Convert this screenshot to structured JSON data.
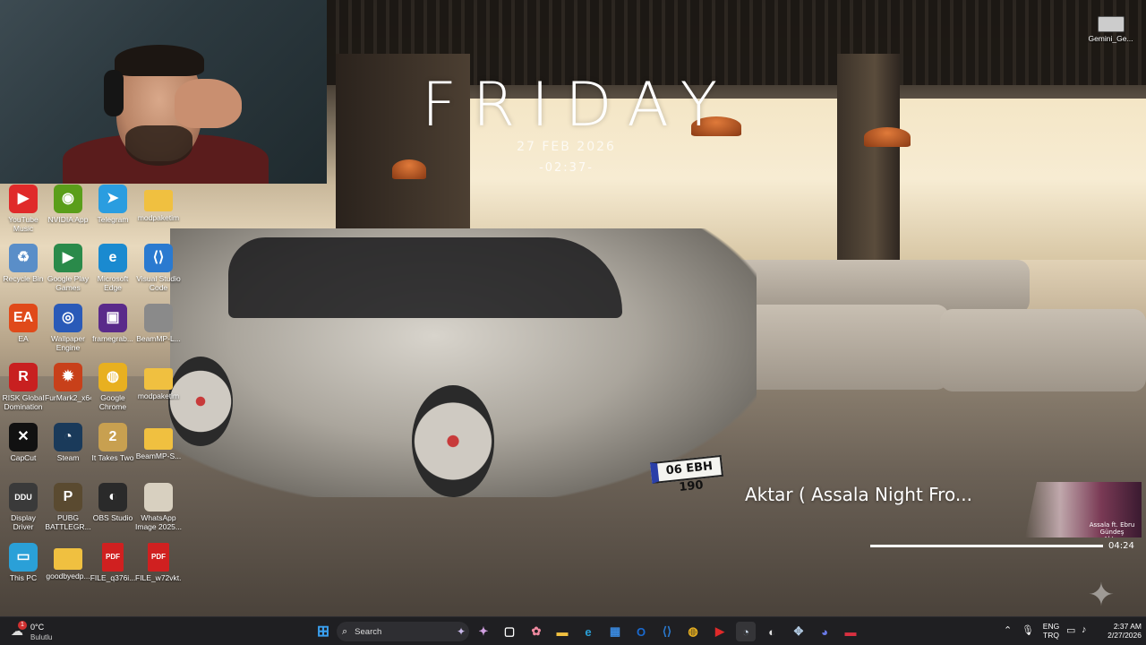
{
  "desktop": {
    "clock_widget": {
      "title": "FRIDAY",
      "date": "27 FEB 2026",
      "time": "-02:37-"
    },
    "icons": [
      {
        "label": "YouTube Music",
        "icon": "youtube-music-icon",
        "color": "#e02a2a",
        "glyph": "▶"
      },
      {
        "label": "NVIDIA App",
        "icon": "nvidia-icon",
        "color": "#5a9e1a",
        "glyph": "◉"
      },
      {
        "label": "Telegram",
        "icon": "telegram-icon",
        "color": "#2a9de0",
        "glyph": "➤"
      },
      {
        "label": "modpaketim",
        "icon": "folder-icon",
        "color": "#f0c040",
        "glyph": ""
      },
      {
        "label": "Recycle Bin",
        "icon": "recycle-bin-icon",
        "color": "#5a8ec8",
        "glyph": "♻"
      },
      {
        "label": "Google Play Games",
        "icon": "google-play-games-icon",
        "color": "#2a8a4a",
        "glyph": "▶"
      },
      {
        "label": "Microsoft Edge",
        "icon": "edge-icon",
        "color": "#1a8ad0",
        "glyph": "e"
      },
      {
        "label": "Visual Studio Code",
        "icon": "vscode-icon",
        "color": "#2a7ad0",
        "glyph": "⟨⟩"
      },
      {
        "label": "EA",
        "icon": "ea-icon",
        "color": "#e04a1a",
        "glyph": "EA"
      },
      {
        "label": "Wallpaper Engine",
        "icon": "wallpaper-engine-icon",
        "color": "#2a5ab8",
        "glyph": "◎"
      },
      {
        "label": "framegrab...",
        "icon": "framegrab-icon",
        "color": "#5a2a8a",
        "glyph": "▣"
      },
      {
        "label": "BeamMP-L...",
        "icon": "beammp-launcher-icon",
        "color": "#8a8a8a",
        "glyph": ""
      },
      {
        "label": "RISK Global Domination",
        "icon": "risk-icon",
        "color": "#c82020",
        "glyph": "R"
      },
      {
        "label": "FurMark2_x64",
        "icon": "furmark-icon",
        "color": "#c8401a",
        "glyph": "✹"
      },
      {
        "label": "Google Chrome",
        "icon": "chrome-icon",
        "color": "#e8b020",
        "glyph": "◍"
      },
      {
        "label": "modpaketim",
        "icon": "folder-icon",
        "color": "#f0c040",
        "glyph": ""
      },
      {
        "label": "CapCut",
        "icon": "capcut-icon",
        "color": "#111111",
        "glyph": "✕"
      },
      {
        "label": "Steam",
        "icon": "steam-icon",
        "color": "#1a3a5a",
        "glyph": "◔"
      },
      {
        "label": "It Takes Two",
        "icon": "it-takes-two-icon",
        "color": "#c8a050",
        "glyph": "2"
      },
      {
        "label": "BeamMP-S...",
        "icon": "folder-icon",
        "color": "#f0c040",
        "glyph": ""
      },
      {
        "label": "Display Driver Uninstaller",
        "icon": "ddu-icon",
        "color": "#3a3a3a",
        "glyph": "DDU"
      },
      {
        "label": "PUBG BATTLEGR...",
        "icon": "pubg-icon",
        "color": "#5a4a30",
        "glyph": "P"
      },
      {
        "label": "OBS Studio",
        "icon": "obs-icon",
        "color": "#2a2a2a",
        "glyph": "◐"
      },
      {
        "label": "WhatsApp Image 2025...",
        "icon": "image-file-icon",
        "color": "#d8d0c0",
        "glyph": ""
      },
      {
        "label": "This PC",
        "icon": "this-pc-icon",
        "color": "#2aa0d8",
        "glyph": "▭"
      },
      {
        "label": "goodbyedp...",
        "icon": "folder-icon",
        "color": "#f0c040",
        "glyph": ""
      },
      {
        "label": "FILE_q376i...",
        "icon": "pdf-icon",
        "color": "#d02020",
        "glyph": "PDF"
      },
      {
        "label": "FILE_w72vkt...",
        "icon": "pdf-icon",
        "color": "#d02020",
        "glyph": "PDF"
      }
    ],
    "corner_item": {
      "label": "Gemini_Ge...",
      "icon": "image-file-icon"
    }
  },
  "car": {
    "plate": "06 EBH 190"
  },
  "media": {
    "title": "Aktar ( Assala Night Fro...",
    "art_text_1": "Assala ft. Ebru Gündeş",
    "art_text_2": "Aktar",
    "time": "04:24",
    "progress": 1.0
  },
  "taskbar": {
    "weather": {
      "temp": "0°C",
      "desc": "Bulutlu",
      "badge": "1"
    },
    "search_placeholder": "Search",
    "apps": [
      {
        "name": "start-button",
        "icon": "windows-icon",
        "color": "#3aa0f0",
        "glyph": "⊞"
      },
      {
        "name": "copilot",
        "icon": "copilot-icon",
        "color": "#d0a0e0",
        "glyph": "✦"
      },
      {
        "name": "task-view",
        "icon": "task-view-icon",
        "color": "#ffffff",
        "glyph": "▢"
      },
      {
        "name": "widgets",
        "icon": "widgets-icon",
        "color": "#f08aa0",
        "glyph": "✿"
      },
      {
        "name": "file-explorer",
        "icon": "folder-icon",
        "color": "#f0c040",
        "glyph": "▬"
      },
      {
        "name": "edge",
        "icon": "edge-icon",
        "color": "#2aa0d8",
        "glyph": "e"
      },
      {
        "name": "store",
        "icon": "store-icon",
        "color": "#3a8ae0",
        "glyph": "▦"
      },
      {
        "name": "outlook",
        "icon": "outlook-icon",
        "color": "#1a6ad0",
        "glyph": "O"
      },
      {
        "name": "vscode",
        "icon": "vscode-icon",
        "color": "#2a7ad0",
        "glyph": "⟨⟩"
      },
      {
        "name": "chrome",
        "icon": "chrome-icon",
        "color": "#e8b020",
        "glyph": "◍"
      },
      {
        "name": "youtube-music",
        "icon": "youtube-music-icon",
        "color": "#e02a2a",
        "glyph": "▶"
      },
      {
        "name": "steam",
        "icon": "steam-icon",
        "color": "#c8d8e8",
        "glyph": "◔"
      },
      {
        "name": "obs",
        "icon": "obs-icon",
        "color": "#e0e0e0",
        "glyph": "◐"
      },
      {
        "name": "network-app",
        "icon": "network-icon",
        "color": "#b0c8e0",
        "glyph": "✥"
      },
      {
        "name": "discord",
        "icon": "discord-icon",
        "color": "#6a7ae8",
        "glyph": "◕"
      },
      {
        "name": "media-app",
        "icon": "media-app-icon",
        "color": "#d83040",
        "glyph": "▬"
      }
    ],
    "tray": {
      "lang_1": "ENG",
      "lang_2": "TRQ",
      "time": "2:37 AM",
      "date": "2/27/2026"
    }
  }
}
